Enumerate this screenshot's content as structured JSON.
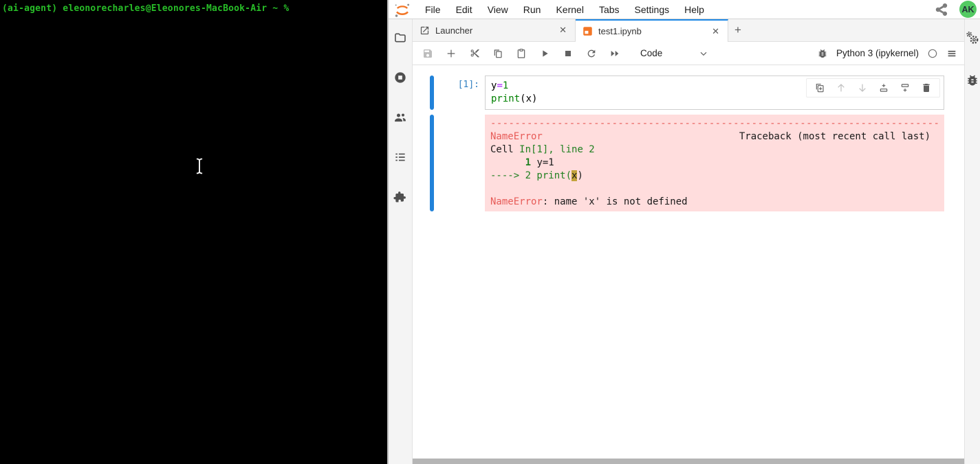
{
  "terminal": {
    "prompt": "(ai-agent) eleonorecharles@Eleonores-MacBook-Air ~ %"
  },
  "menubar": {
    "items": [
      "File",
      "Edit",
      "View",
      "Run",
      "Kernel",
      "Tabs",
      "Settings",
      "Help"
    ],
    "avatar_initials": "AK"
  },
  "tabs": [
    {
      "label": "Launcher"
    },
    {
      "label": "test1.ipynb"
    }
  ],
  "glyphs": {
    "close": "✕",
    "add": "+"
  },
  "toolbar": {
    "cell_type": "Code",
    "kernel_name": "Python 3 (ipykernel)"
  },
  "cell": {
    "prompt": "[1]:",
    "line1": {
      "var": "y",
      "op": "=",
      "num": "1"
    },
    "line2": {
      "fn": "print",
      "open": "(",
      "arg": "x",
      "close": ")"
    }
  },
  "output": {
    "rule": "---------------------------------------------------------------------------",
    "error_type": "NameError",
    "traceback_header": "Traceback (most recent call last)",
    "cell_label": "Cell ",
    "cell_ref": "In[1], line 2",
    "ctx1_indent": "      ",
    "ctx1_lineno": "1",
    "ctx1_code": " y=1",
    "ctx2_prefix": "----> 2 print(",
    "ctx2_highlight": "x",
    "ctx2_suffix": ")",
    "final_error": "NameError",
    "final_message": ": name 'x' is not defined"
  },
  "icons": {
    "left_sidebar": [
      "file-browser-icon",
      "running-kernels-icon",
      "collaborators-icon",
      "table-of-contents-icon",
      "extensions-icon"
    ],
    "right_sidebar": [
      "property-inspector-icon",
      "debugger-icon"
    ],
    "toolbar": [
      "save-icon",
      "add-cell-icon",
      "cut-icon",
      "copy-icon",
      "paste-icon",
      "run-icon",
      "stop-icon",
      "restart-icon",
      "run-all-icon",
      "debugger-icon",
      "kernel-status-icon",
      "menu-icon"
    ],
    "cell_toolbar": [
      "duplicate-cell-icon",
      "move-up-icon",
      "move-down-icon",
      "insert-above-icon",
      "insert-below-icon",
      "delete-cell-icon"
    ]
  },
  "colors": {
    "terminal_green": "#28be28",
    "jupyter_orange": "#f37626",
    "accent_blue": "#2182d9",
    "error_bg": "#ffdddd",
    "error_red": "#e75c58",
    "ansi_green": "#208020",
    "highlight_yellow": "#c3a33c",
    "avatar_green": "#54ca63"
  }
}
